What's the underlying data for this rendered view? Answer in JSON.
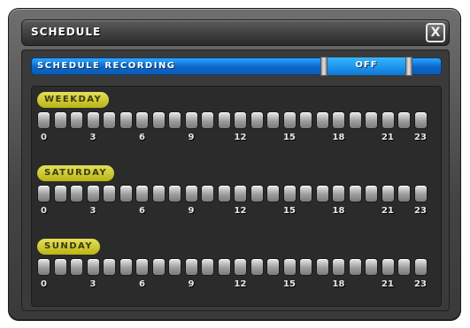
{
  "window": {
    "title": "SCHEDULE",
    "close_label": "X"
  },
  "recording": {
    "label": "SCHEDULE RECORDING",
    "value": "OFF"
  },
  "days": [
    {
      "label": "WEEKDAY",
      "active_hours": []
    },
    {
      "label": "SATURDAY",
      "active_hours": []
    },
    {
      "label": "SUNDAY",
      "active_hours": []
    }
  ],
  "hour_count": 24,
  "hour_ticks": [
    "0",
    "3",
    "6",
    "9",
    "12",
    "15",
    "18",
    "21",
    "23"
  ],
  "colors": {
    "recording_bar": "#0a66c8",
    "day_label": "#d8d32a",
    "hour_off": "#a9a9a9",
    "hour_on": "#3caa2a"
  }
}
